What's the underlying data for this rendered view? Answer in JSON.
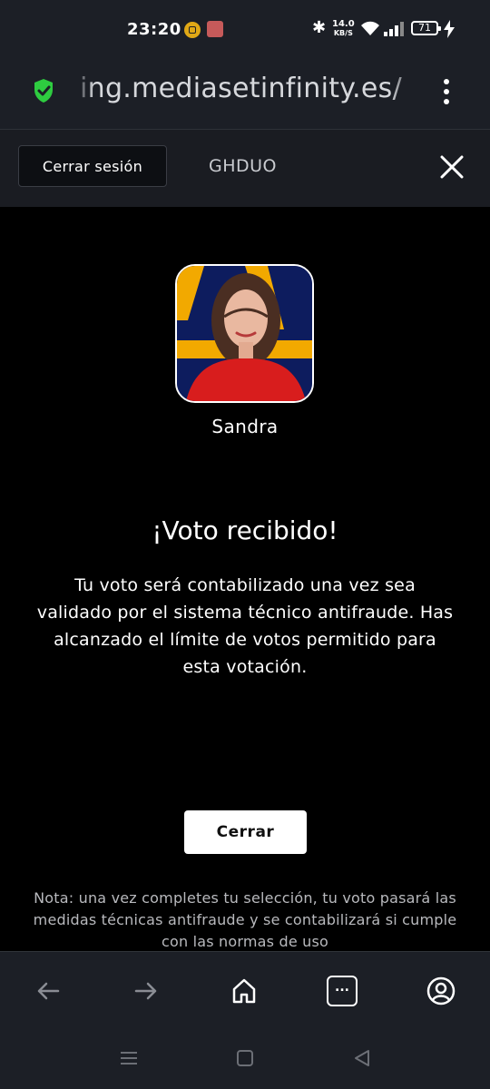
{
  "status_bar": {
    "time": "23:20",
    "net_speed_value": "14.0",
    "net_speed_unit": "KB/S",
    "battery": "71"
  },
  "browser": {
    "url": "ing.mediasetinfinity.es/",
    "secure_icon": "shield-check-icon",
    "menu_icon": "more-vert-icon"
  },
  "header": {
    "logout_label": "Cerrar sesión",
    "program_code": "GHDUO",
    "close_icon": "close-icon"
  },
  "contestant": {
    "name": "Sandra"
  },
  "confirmation": {
    "title": "¡Voto recibido!",
    "message": "Tu voto será contabilizado una vez sea validado por el sistema técnico antifraude. Has alcanzado el límite de votos permitido para esta votación.",
    "close_label": "Cerrar",
    "note": "Nota: una vez completes tu selección, tu voto pasará las medidas técnicas antifraude y se contabilizará si cumple con las normas de uso"
  },
  "toolbar": {
    "items": [
      "back-icon",
      "forward-icon",
      "home-icon",
      "tabs-icon",
      "account-icon"
    ],
    "tabs_label": "..."
  },
  "colors": {
    "accent_green": "#2ecc40",
    "avatar_bg_blue": "#0d1c5e",
    "avatar_yellow": "#f2a900",
    "avatar_red": "#d81d1d"
  }
}
